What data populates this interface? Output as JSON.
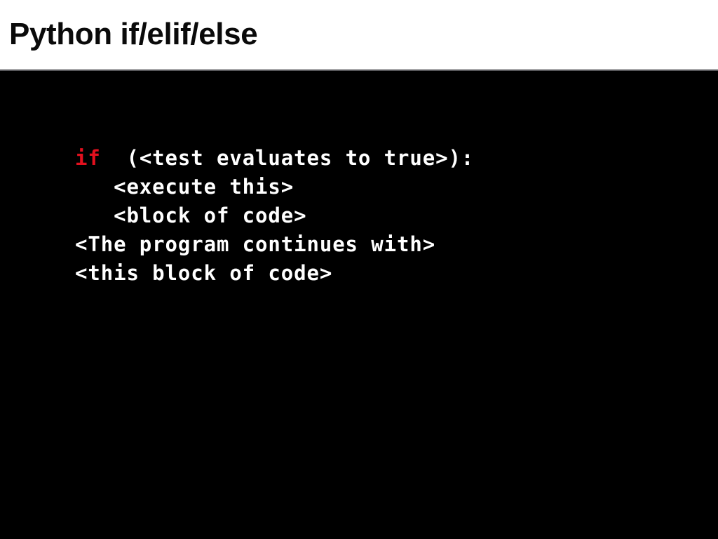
{
  "slide": {
    "title": "Python if/elif/else",
    "background_color": "#000000",
    "header_background_color": "#ffffff",
    "header_text_color": "#0a0a0a",
    "rule_color": "#57575a"
  },
  "code": {
    "keyword_color": "#e3101e",
    "text_color": "#ffffff",
    "lines": [
      {
        "id": "line-if-condition",
        "keyword": "if",
        "rest": "  (<test evaluates to true>):"
      },
      {
        "id": "line-execute-this",
        "keyword": "",
        "rest": "   <execute this>"
      },
      {
        "id": "line-block-of-code",
        "keyword": "",
        "rest": "   <block of code>"
      },
      {
        "id": "line-program-continues",
        "keyword": "",
        "rest": "<The program continues with>"
      },
      {
        "id": "line-this-block-of-code",
        "keyword": "",
        "rest": "<this block of code>"
      }
    ]
  }
}
